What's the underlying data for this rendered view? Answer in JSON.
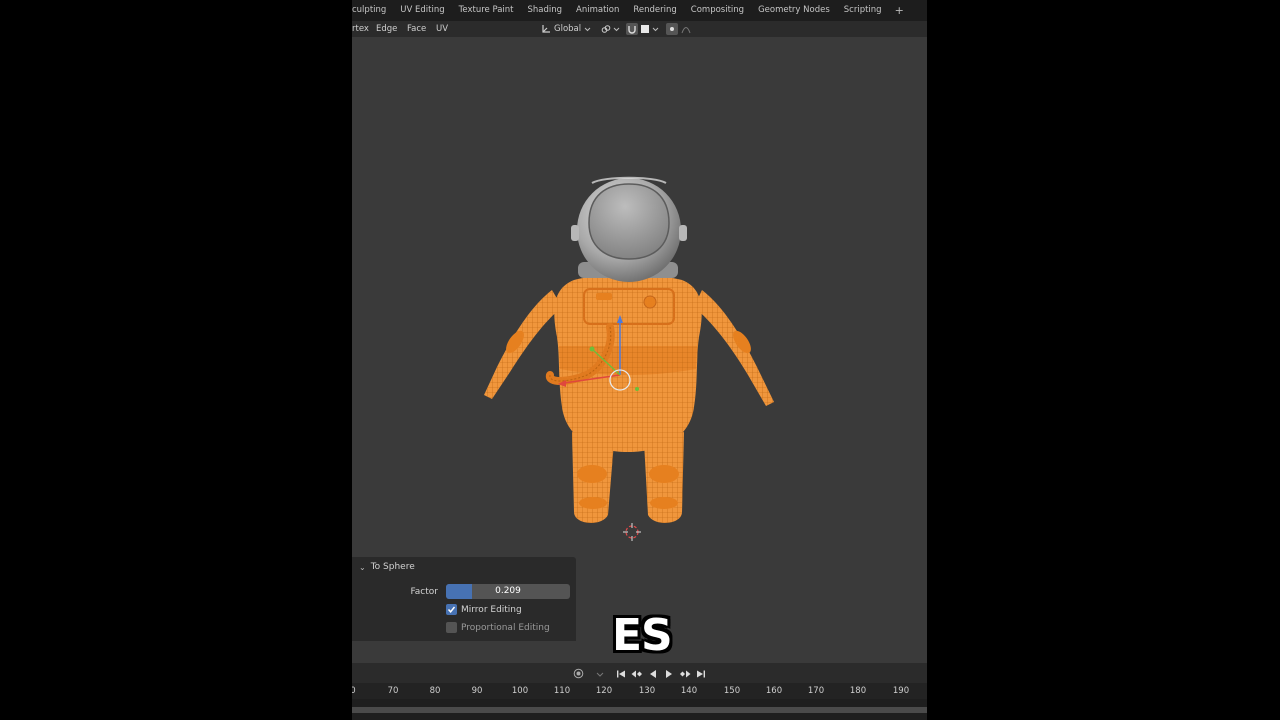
{
  "workspace_tabs": [
    "culpting",
    "UV Editing",
    "Texture Paint",
    "Shading",
    "Animation",
    "Rendering",
    "Compositing",
    "Geometry Nodes",
    "Scripting"
  ],
  "workspace_add": "+",
  "header": {
    "menu": [
      "rtex",
      "Edge",
      "Face",
      "UV"
    ],
    "orientation": "Global"
  },
  "operator_panel": {
    "title": "To Sphere",
    "factor_label": "Factor",
    "factor_value": "0.209",
    "factor_fraction": 0.209,
    "mirror_editing": {
      "label": "Mirror Editing",
      "checked": true
    },
    "proportional_editing": {
      "label": "Proportional Editing",
      "checked": false
    }
  },
  "subtitle": "ES",
  "timeline": {
    "ruler_ticks": [
      "0",
      "70",
      "80",
      "90",
      "100",
      "110",
      "120",
      "130",
      "140",
      "150",
      "160",
      "170",
      "180",
      "190"
    ]
  },
  "colors": {
    "accent": "#4772b3",
    "selection_orange": "#f0963c",
    "viewport_bg": "#3a3a3a"
  }
}
